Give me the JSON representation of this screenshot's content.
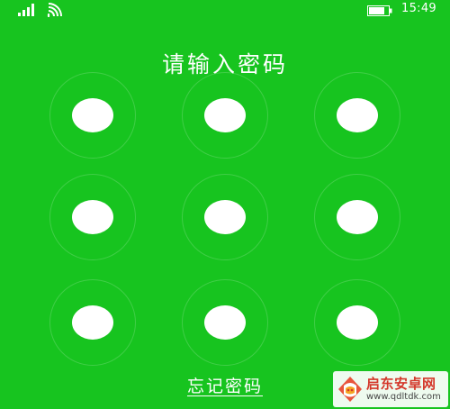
{
  "status_bar": {
    "time": "15:49",
    "icons": [
      "signal-icon",
      "wifi-icon",
      "battery-icon"
    ]
  },
  "title": "请输入密码",
  "pattern": {
    "dots": [
      {
        "name": "pattern-dot-1"
      },
      {
        "name": "pattern-dot-2"
      },
      {
        "name": "pattern-dot-3"
      },
      {
        "name": "pattern-dot-4"
      },
      {
        "name": "pattern-dot-5"
      },
      {
        "name": "pattern-dot-6"
      },
      {
        "name": "pattern-dot-7"
      },
      {
        "name": "pattern-dot-8"
      },
      {
        "name": "pattern-dot-9"
      }
    ]
  },
  "forgot_password": "忘记密码",
  "watermark": {
    "name": "启东安卓网",
    "url": "www.qdltdk.com"
  },
  "colors": {
    "background": "#17c41f",
    "dot": "#ffffff",
    "text": "#ffffff",
    "watermark_red": "#d4372a"
  }
}
